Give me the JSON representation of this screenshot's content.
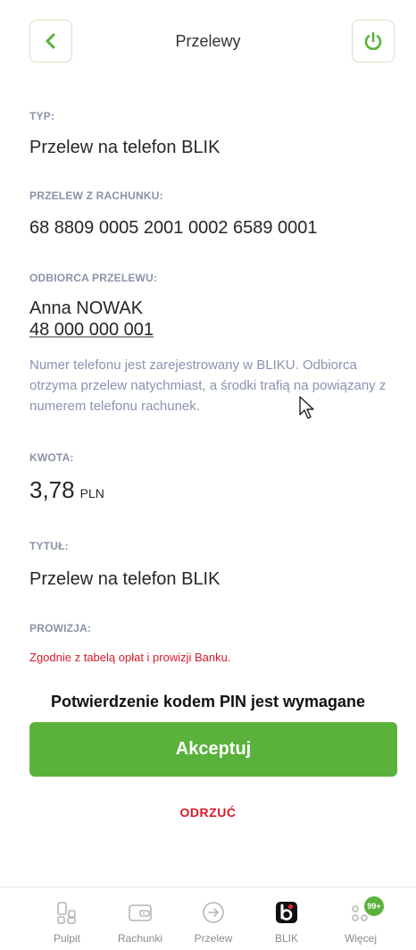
{
  "header": {
    "title": "Przelewy"
  },
  "sections": {
    "type": {
      "label": "TYP:",
      "value": "Przelew na telefon BLIK"
    },
    "from_account": {
      "label": "PRZELEW Z RACHUNKU:",
      "value": "68 8809 0005 2001 0002 6589 0001"
    },
    "recipient": {
      "label": "ODBIORCA PRZELEWU:",
      "name": "Anna NOWAK",
      "phone": "48 000 000 001",
      "hint": "Numer telefonu jest zarejestrowany w BLIKU. Odbiorca otrzyma przelew natychmiast, a środki trafią na powiązany z numerem telefonu rachunek."
    },
    "amount": {
      "label": "KWOTA:",
      "value": "3,78",
      "currency": "PLN"
    },
    "title": {
      "label": "TYTUŁ:",
      "value": "Przelew na telefon BLIK"
    },
    "fee": {
      "label": "PROWIZJA:",
      "value": "Zgodnie z tabelą opłat i prowizji Banku."
    }
  },
  "confirm": {
    "pin_required": "Potwierdzenie kodem PIN jest wymagane",
    "accept_label": "Akceptuj",
    "reject_label": "ODRZUĆ"
  },
  "tabbar": {
    "items": [
      {
        "label": "Pulpit",
        "icon": "dashboard-icon"
      },
      {
        "label": "Rachunki",
        "icon": "wallet-icon"
      },
      {
        "label": "Przelew",
        "icon": "arrow-circle-icon"
      },
      {
        "label": "BLIK",
        "icon": "blik-icon"
      },
      {
        "label": "Więcej",
        "icon": "more-icon",
        "badge": "99+"
      }
    ]
  },
  "colors": {
    "accent": "#5ab23c",
    "danger": "#d61a2a",
    "label": "#8a93a8"
  }
}
